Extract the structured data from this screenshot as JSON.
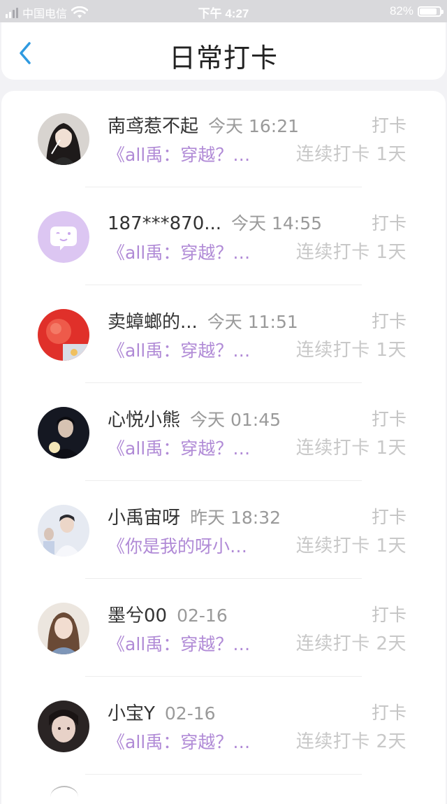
{
  "status_bar": {
    "carrier": "中国电信",
    "time": "下午 4:27",
    "battery": "82%",
    "battery_level": 0.82
  },
  "header": {
    "title": "日常打卡",
    "back_icon": "chevron-left-icon"
  },
  "colors": {
    "accent_purple": "#b08ad6",
    "back_blue": "#2f9ae0",
    "status_bar": "#d9d9dc"
  },
  "checkins": [
    {
      "name": "南鸢惹不起",
      "time": "今天 16:21",
      "label": "打卡",
      "work": "《all禹：穿越？…",
      "streak": "连续打卡 1天"
    },
    {
      "name": "187***870...",
      "time": "今天 14:55",
      "label": "打卡",
      "work": "《all禹：穿越？…",
      "streak": "连续打卡 1天"
    },
    {
      "name": "卖蟑螂的...",
      "time": "今天 11:51",
      "label": "打卡",
      "work": "《all禹：穿越？…",
      "streak": "连续打卡 1天"
    },
    {
      "name": "心悦小熊",
      "time": "今天 01:45",
      "label": "打卡",
      "work": "《all禹：穿越？…",
      "streak": "连续打卡 1天"
    },
    {
      "name": "小禹宙呀",
      "time": "昨天 18:32",
      "label": "打卡",
      "work": "《你是我的呀小…",
      "streak": "连续打卡 1天"
    },
    {
      "name": "墨兮00",
      "time": "02-16",
      "label": "打卡",
      "work": "《all禹：穿越？…",
      "streak": "连续打卡 2天"
    },
    {
      "name": "小宝Y",
      "time": "02-16",
      "label": "打卡",
      "work": "《all禹：穿越？…",
      "streak": "连续打卡 2天"
    }
  ]
}
